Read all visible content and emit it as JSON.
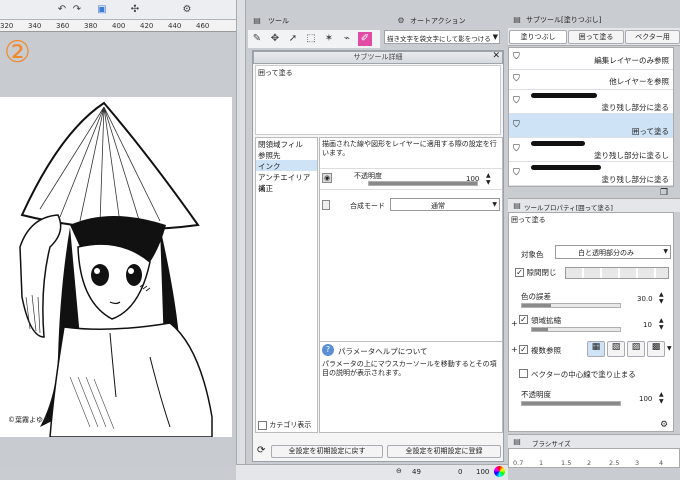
{
  "ruler": {
    "ticks": [
      "320",
      "340",
      "360",
      "380",
      "400",
      "420",
      "440",
      "460"
    ]
  },
  "canvas": {
    "step_number": "②",
    "credit": "©葉霧よゆみ"
  },
  "tool_panel": {
    "title": "ツール"
  },
  "auto_action": {
    "title": "オートアクション",
    "selected": "描き文字を袋文字にして影をつける"
  },
  "subtool_detail": {
    "title": "サブツール詳細",
    "subtitle": "囲って塗る",
    "categories": [
      "閉領域フィル",
      "参照先",
      "インク",
      "アンチエイリアス",
      "補正"
    ],
    "selected_category": "インク",
    "description": "描画された線や図形をレイヤーに適用する際の設定を行います。",
    "opacity_label": "不透明度",
    "opacity_value": "100",
    "blend_label": "合成モード",
    "blend_value": "通常",
    "show_category": "カテゴリ表示",
    "help_title": "パラメータヘルプについて",
    "help_text": "パラメータの上にマウスカーソールを移動するとその項目の説明が表示されます。",
    "reset_button": "全設定を初期設定に戻す",
    "register_button": "全設定を初期設定に登録"
  },
  "subtool_panel": {
    "title": "サブツール[塗りつぶし]",
    "tabs": [
      "塗りつぶし",
      "囲って塗る",
      "ベクター用"
    ],
    "items": [
      "編集レイヤーのみ参照",
      "他レイヤーを参照",
      "塗り残し部分に塗る",
      "囲って塗る",
      "塗り残し部分に塗るし",
      "塗り残し部分に塗る"
    ],
    "selected_index": 3
  },
  "tool_property": {
    "title": "ツールプロパティ[囲って塗る]",
    "subtitle": "囲って塗る",
    "target_color_label": "対象色",
    "target_color_value": "白と透明部分のみ",
    "gap_close_label": "隙間閉じ",
    "color_margin_label": "色の誤差",
    "color_margin_value": "30.0",
    "area_scaling_label": "領域拡縮",
    "area_scaling_value": "10",
    "multi_reference_label": "複数参照",
    "vector_center_label": "ベクターの中心線で塗り止まる",
    "opacity_label": "不透明度",
    "opacity_value": "100"
  },
  "brush_size": {
    "title": "ブラシサイズ",
    "sizes": [
      "0.7",
      "1",
      "1.5",
      "2",
      "2.5",
      "3",
      "4"
    ]
  },
  "status": {
    "zoom": "49",
    "angle": "0",
    "opacity": "100"
  }
}
